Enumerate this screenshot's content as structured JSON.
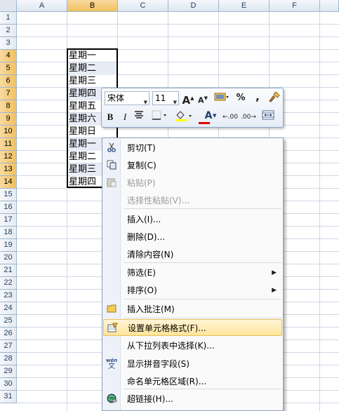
{
  "columns": [
    "A",
    "B",
    "C",
    "D",
    "E",
    "F"
  ],
  "rows": [
    "1",
    "2",
    "3",
    "4",
    "5",
    "6",
    "7",
    "8",
    "9",
    "10",
    "11",
    "12",
    "13",
    "14",
    "15",
    "16",
    "17",
    "18",
    "19",
    "20",
    "21",
    "22",
    "23",
    "24",
    "25",
    "26",
    "27",
    "28",
    "29",
    "30",
    "31"
  ],
  "cells_b": [
    "星期一",
    "星期二",
    "星期三",
    "星期四",
    "星期五",
    "星期六",
    "星期日",
    "星期一",
    "星期二",
    "星期三",
    "星期四"
  ],
  "minibar": {
    "font_name": "宋体",
    "font_size": "11",
    "grow_font": "A",
    "shrink_font": "A",
    "percent": "%",
    "comma": ",",
    "bold": "B",
    "italic": "I",
    "font_color": "A",
    "inc_decimal": ".00",
    "dec_decimal": ".00"
  },
  "context_menu": {
    "items": [
      {
        "label": "剪切(T)",
        "icon": "scissors-icon",
        "enabled": true
      },
      {
        "label": "复制(C)",
        "icon": "copy-icon",
        "enabled": true
      },
      {
        "label": "粘贴(P)",
        "icon": "paste-icon",
        "enabled": false
      },
      {
        "label": "选择性粘贴(V)...",
        "icon": "",
        "enabled": false
      },
      {
        "label": "插入(I)...",
        "icon": "",
        "enabled": true
      },
      {
        "label": "删除(D)...",
        "icon": "",
        "enabled": true
      },
      {
        "label": "清除内容(N)",
        "icon": "",
        "enabled": true
      },
      {
        "label": "筛选(E)",
        "icon": "",
        "enabled": true,
        "submenu": true
      },
      {
        "label": "排序(O)",
        "icon": "",
        "enabled": true,
        "submenu": true
      },
      {
        "label": "插入批注(M)",
        "icon": "comment-icon",
        "enabled": true
      },
      {
        "label": "设置单元格格式(F)...",
        "icon": "format-cells-icon",
        "enabled": true,
        "highlighted": true
      },
      {
        "label": "从下拉列表中选择(K)...",
        "icon": "",
        "enabled": true
      },
      {
        "label": "显示拼音字段(S)",
        "icon": "phonetic-icon",
        "enabled": true
      },
      {
        "label": "命名单元格区域(R)...",
        "icon": "",
        "enabled": true
      },
      {
        "label": "超链接(H)...",
        "icon": "hyperlink-icon",
        "enabled": true
      }
    ],
    "phonetic_glyph": "wén",
    "phonetic_char": "文"
  },
  "colors": {
    "header_selected": "#f1c15f",
    "menu_highlight": "#ffe49a",
    "font_color_bar": "#e00000",
    "fill_color_bar": "#ffff00"
  }
}
